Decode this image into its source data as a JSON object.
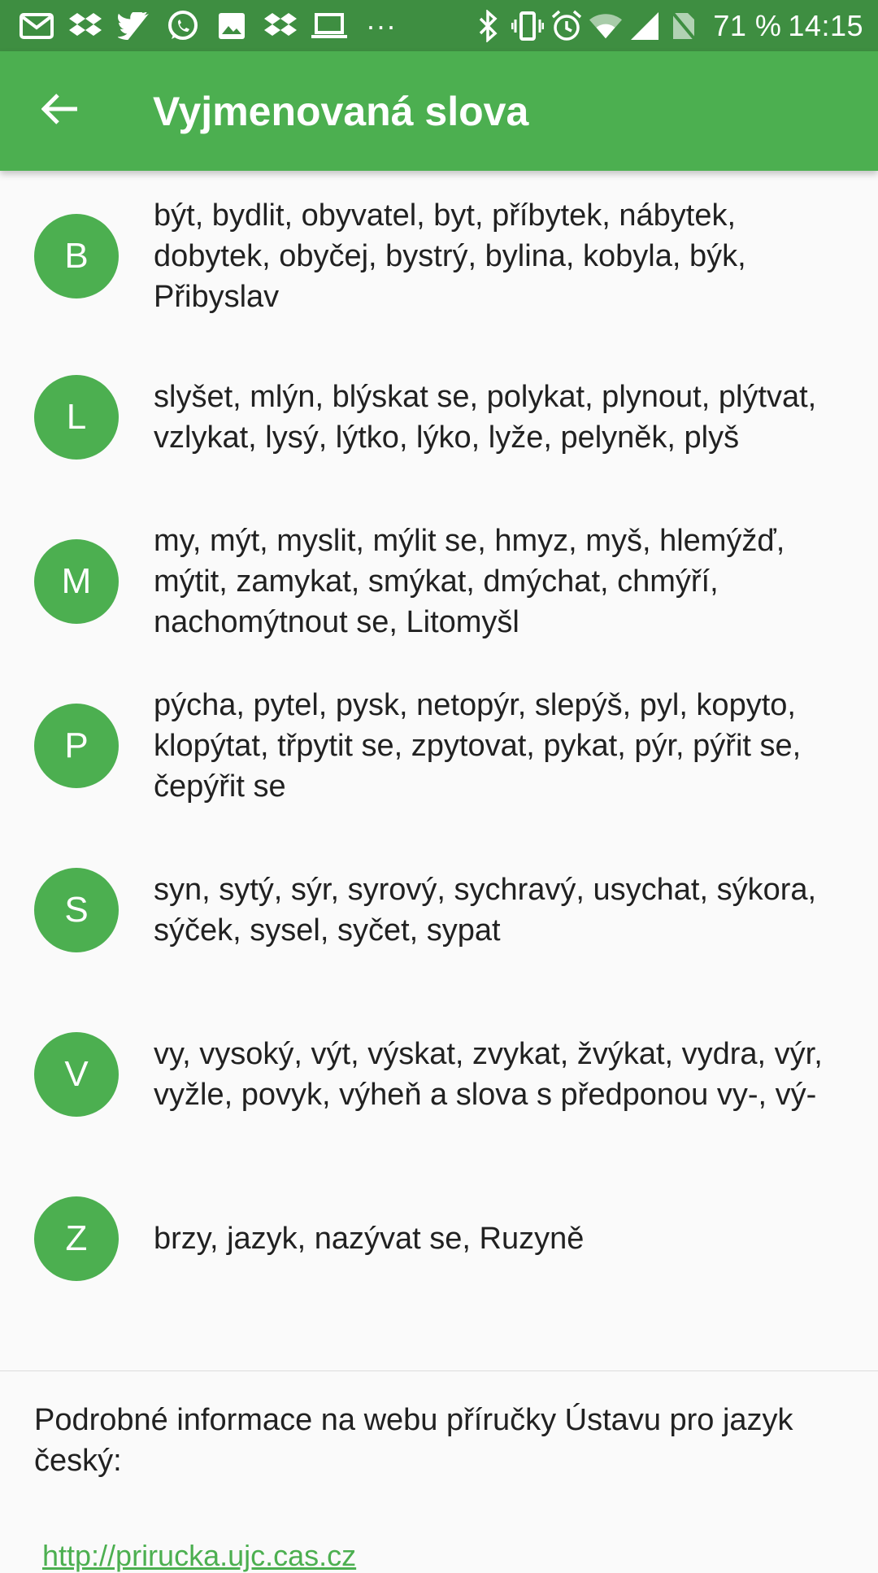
{
  "status_bar": {
    "battery_percent": "71 %",
    "time": "14:15",
    "overflow": "···",
    "notification_icons": [
      "gmail-icon",
      "dropbox-icon",
      "twitter-icon",
      "whatsapp-icon",
      "gallery-icon",
      "dropbox-icon",
      "laptop-icon"
    ],
    "system_icons": [
      "bluetooth-icon",
      "vibrate-icon",
      "alarm-icon",
      "wifi-icon",
      "signal-icon",
      "no-sim-icon"
    ]
  },
  "app_bar": {
    "title": "Vyjmenovaná slova",
    "back_icon": "arrow-back-icon"
  },
  "colors": {
    "status_bar": "#3e8e41",
    "app_bar": "#4caf50",
    "accent": "#4caf50",
    "background": "#fafafa",
    "text": "#212121"
  },
  "word_list": [
    {
      "letter": "B",
      "words": "být, bydlit, obyvatel, byt, příbytek, nábytek, dobytek, obyčej, bystrý, bylina, kobyla, býk, Přibyslav"
    },
    {
      "letter": "L",
      "words": "slyšet, mlýn, blýskat se, polykat, plynout, plýtvat, vzlykat, lysý, lýtko, lýko, lyže, pelyněk, plyš"
    },
    {
      "letter": "M",
      "words": "my, mýt, myslit, mýlit se, hmyz, myš, hlemýžď, mýtit, zamykat, smýkat, dmýchat, chmýří, nachomýtnout se, Litomyšl"
    },
    {
      "letter": "P",
      "words": "pýcha, pytel, pysk, netopýr, slepýš, pyl, kopyto, klopýtat, třpytit se, zpytovat, pykat, pýr, pýřit se, čepýřit se"
    },
    {
      "letter": "S",
      "words": "syn, sytý, sýr, syrový, sychravý, usychat, sýkora, sýček, sysel, syčet, sypat"
    },
    {
      "letter": "V",
      "words": "vy, vysoký, výt, výskat, zvykat, žvýkat, vydra, výr, vyžle, povyk, výheň a slova s předponou vy-, vý-"
    },
    {
      "letter": "Z",
      "words": "brzy, jazyk, nazývat se, Ruzyně"
    }
  ],
  "info": {
    "text": "Podrobné informace na webu příručky Ústavu pro jazyk český:",
    "link": "http://prirucka.ujc.cas.cz"
  }
}
